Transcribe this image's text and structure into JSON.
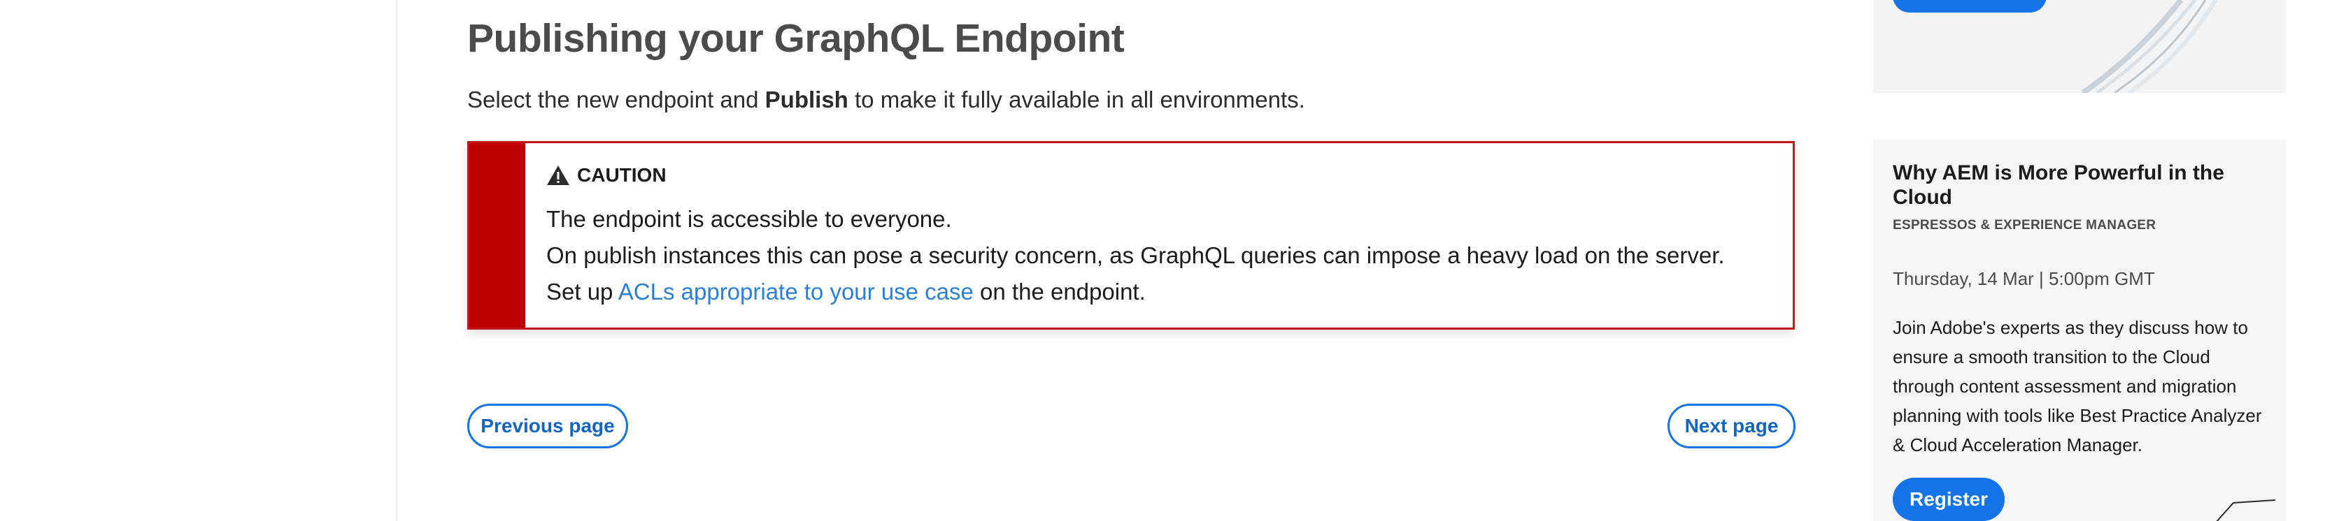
{
  "article": {
    "title": "Publishing your GraphQL Endpoint",
    "intro_before": "Select the new endpoint and ",
    "intro_bold": "Publish",
    "intro_after": " to make it fully available in all environments."
  },
  "caution": {
    "label": "CAUTION",
    "line1": "The endpoint is accessible to everyone.",
    "line2": "On publish instances this can pose a security concern, as GraphQL queries can impose a heavy load on the server.",
    "line3_before": "Set up ",
    "line3_link": "ACLs appropriate to your use case",
    "line3_after": " on the endpoint.",
    "bar_color": "#bd0000"
  },
  "pagination": {
    "previous": "Previous page",
    "next": "Next page"
  },
  "sidebar": {
    "event": {
      "title": "Why AEM is More Powerful in the Cloud",
      "category": "ESPRESSOS & EXPERIENCE MANAGER",
      "date": "Thursday, 14 Mar | 5:00pm GMT",
      "description": "Join Adobe's experts as they discuss how to ensure a smooth transition to the Cloud through content assessment and migration planning with tools like Best Practice Analyzer & Cloud Acceleration Manager.",
      "register_label": "Register"
    }
  },
  "colors": {
    "accent": "#1473e6",
    "link": "#2b7fd4",
    "caution": "#bd0000"
  }
}
